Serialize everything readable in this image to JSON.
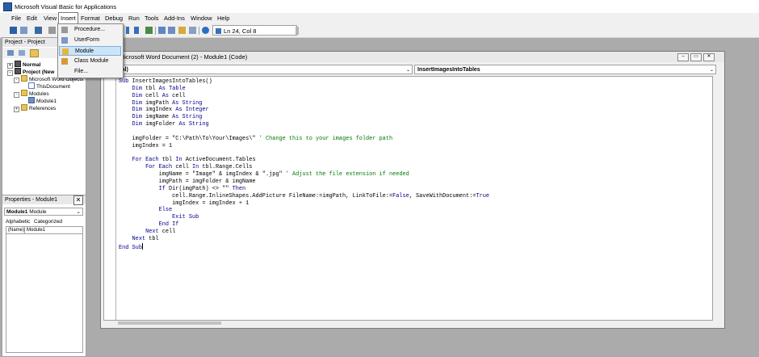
{
  "window": {
    "title": "Microsoft Visual Basic for Applications"
  },
  "menubar": {
    "items": [
      "File",
      "Edit",
      "View",
      "Insert",
      "Format",
      "Debug",
      "Run",
      "Tools",
      "Add-Ins",
      "Window",
      "Help"
    ],
    "active": "Insert"
  },
  "insert_menu": {
    "items": [
      "Procedure...",
      "UserForm",
      "Module",
      "Class Module",
      "File..."
    ],
    "highlighted": "Module"
  },
  "toolbar": {
    "position": "Ln 24, Col 8"
  },
  "project_panel": {
    "title": "Project - Project",
    "tree": {
      "normal": "Normal",
      "project": "Project (New",
      "word_objects": "Microsoft Word Objects",
      "this_document": "ThisDocument",
      "modules": "Modules",
      "module1": "Module1",
      "references": "References"
    }
  },
  "properties_panel": {
    "title": "Properties - Module1",
    "object_name": "Module1",
    "object_type": "Module",
    "tabs": [
      "Alphabetic",
      "Categorized"
    ],
    "row_name": "(Name)",
    "row_value": "Module1"
  },
  "code_window": {
    "title": "Microsoft Word Document (2) - Module1 (Code)",
    "object_combo": "eral)",
    "proc_combo": "InsertImagesIntoTables",
    "lines": [
      "Sub InsertImagesIntoTables()",
      "    Dim tbl As Table",
      "    Dim cell As cell",
      "    Dim imgPath As String",
      "    Dim imgIndex As Integer",
      "    Dim imgName As String",
      "    Dim imgFolder As String",
      "",
      "    imgFolder = \"C:\\Path\\To\\Your\\Images\\\" ' Change this to your images folder path",
      "    imgIndex = 1",
      "",
      "    For Each tbl In ActiveDocument.Tables",
      "        For Each cell In tbl.Range.Cells",
      "            imgName = \"Image\" & imgIndex & \".jpg\" ' Adjust the file extension if needed",
      "            imgPath = imgFolder & imgName",
      "            If Dir(imgPath) <> \"\" Then",
      "                cell.Range.InlineShapes.AddPicture FileName:=imgPath, LinkToFile:=False, SaveWithDocument:=True",
      "                imgIndex = imgIndex + 1",
      "            Else",
      "                Exit Sub",
      "            End If",
      "        Next cell",
      "    Next tbl",
      "End Sub"
    ]
  },
  "colors": {
    "keyword": "#00008b",
    "comment": "#007a00",
    "highlight": "#cce4f7"
  }
}
